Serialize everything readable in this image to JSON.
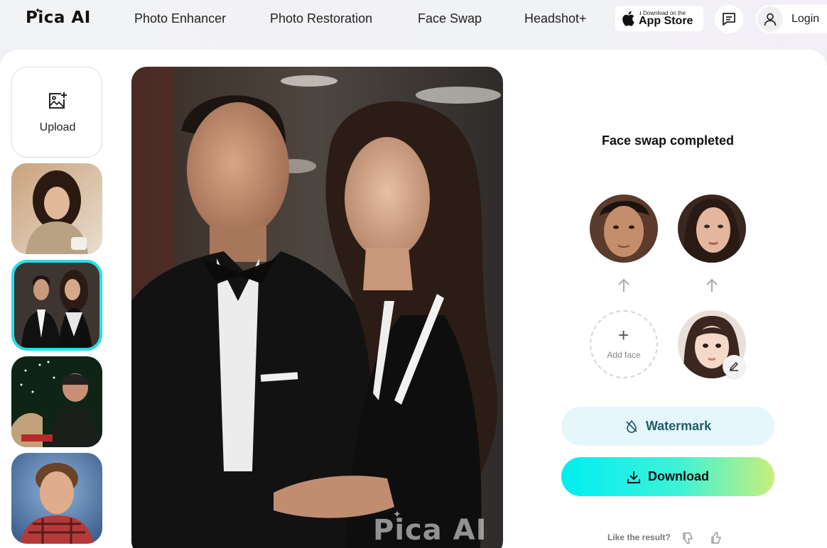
{
  "header": {
    "logo": "Pica AI",
    "nav": [
      "Photo Enhancer",
      "Photo Restoration",
      "Face Swap",
      "Headshot+"
    ],
    "app_store": {
      "small": "Download on the",
      "big": "App Store"
    },
    "login_label": "Login"
  },
  "sidebar": {
    "upload_label": "Upload",
    "thumbnails": [
      "woman-with-sweater",
      "couple-in-formalwear",
      "man-in-christmas-scene",
      "boy-in-plaid-shirt"
    ],
    "selected_index": 1
  },
  "result": {
    "watermark": "Pica AI"
  },
  "panel": {
    "status_title": "Face swap completed",
    "add_face_label": "Add face",
    "watermark_button": "Watermark",
    "download_button": "Download",
    "feedback_prompt": "Like the result?"
  },
  "colors": {
    "accent_cyan": "#21e0ea",
    "download_gradient_start": "#00eef2",
    "download_gradient_end": "#c7f07a",
    "watermark_button_bg": "#e6f7fb"
  }
}
